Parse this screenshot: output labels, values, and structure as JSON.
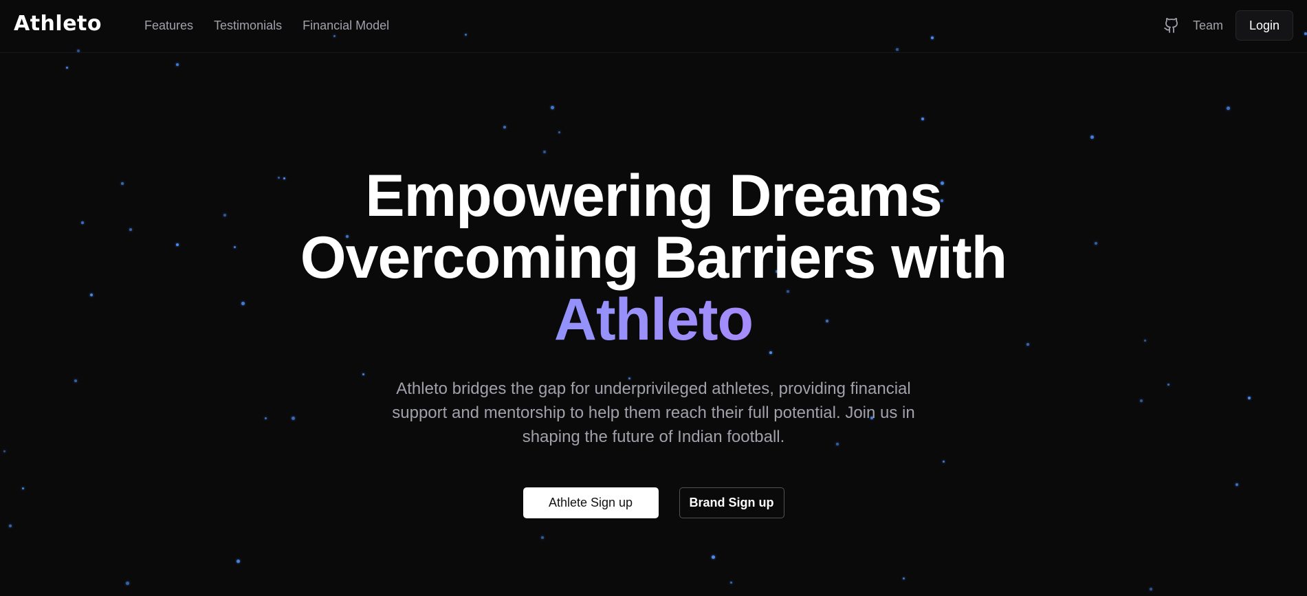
{
  "header": {
    "logo": "Athleto",
    "nav": [
      {
        "label": "Features"
      },
      {
        "label": "Testimonials"
      },
      {
        "label": "Financial Model"
      }
    ],
    "github_icon": "github-icon",
    "team_label": "Team",
    "login_label": "Login"
  },
  "hero": {
    "title_line1": "Empowering Dreams",
    "title_line2": "Overcoming Barriers with",
    "title_highlight": "Athleto",
    "subtitle": "Athleto bridges the gap for underprivileged athletes, providing financial support and mentorship to help them reach their full potential. Join us in shaping the future of Indian football.",
    "athlete_signup_label": "Athlete Sign up",
    "brand_signup_label": "Brand Sign up"
  },
  "colors": {
    "background": "#0a0a0b",
    "star": "#4f8ff7",
    "gradient_start": "#60a5fa",
    "gradient_end": "#c084fc",
    "muted_text": "#a1a1aa"
  }
}
